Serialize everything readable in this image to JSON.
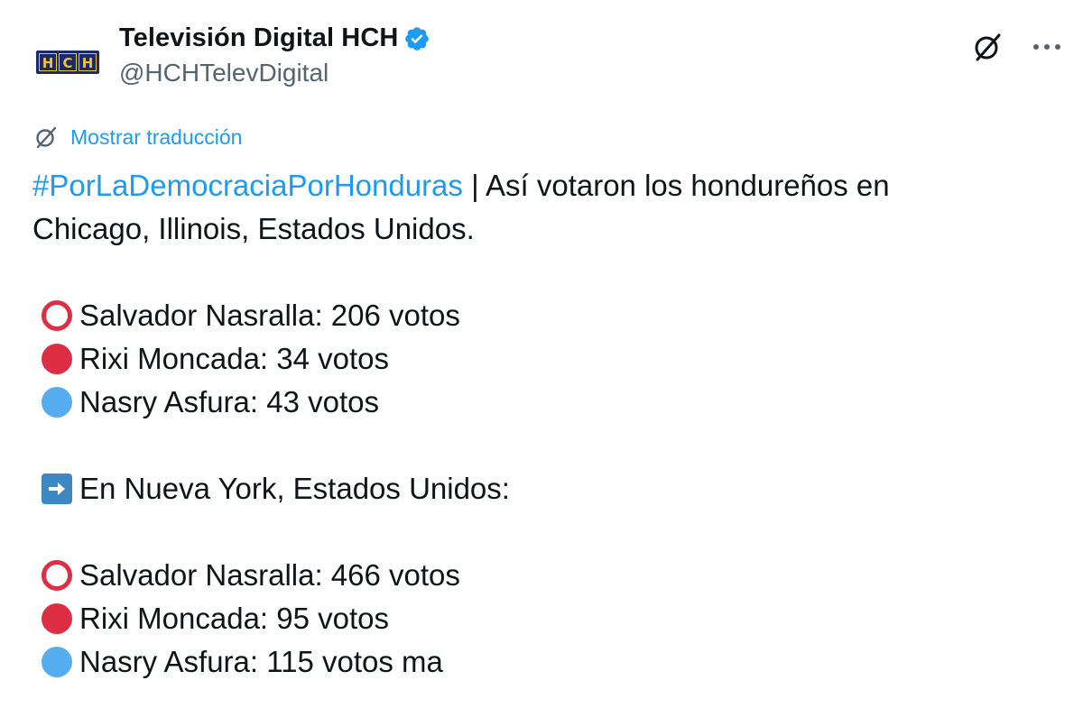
{
  "account": {
    "display_name": "Televisión Digital HCH",
    "handle": "@HCHTelevDigital",
    "logo_letters": [
      "H",
      "C",
      "H"
    ],
    "verified_color": "#1d9bf0"
  },
  "actions": {
    "grok_icon": "grok-slash-icon",
    "more_icon": "more-dots-icon"
  },
  "translate": {
    "label": "Mostrar traducción",
    "icon": "grok-slash-icon"
  },
  "tweet": {
    "hashtag": "#PorLaDemocraciaPorHonduras",
    "intro_rest": " | Así votaron los hondureños en",
    "intro_line2": "Chicago, Illinois, Estados Unidos.",
    "chicago": [
      {
        "icon": "red-ring-icon",
        "text": "Salvador Nasralla: 206 votos"
      },
      {
        "icon": "red-circle-icon",
        "text": "Rixi Moncada: 34 votos"
      },
      {
        "icon": "blue-circle-icon",
        "text": "Nasry Asfura: 43 votos"
      }
    ],
    "ny_heading": "En Nueva York, Estados Unidos:",
    "ny_icon": "right-arrow-icon",
    "new_york": [
      {
        "icon": "red-ring-icon",
        "text": "Salvador Nasralla: 466 votos"
      },
      {
        "icon": "red-circle-icon",
        "text": "Rixi Moncada: 95 votos"
      },
      {
        "icon": "blue-circle-icon",
        "text": "Nasry Asfura: 115 votos ma"
      }
    ]
  },
  "colors": {
    "link": "#1d9bf0",
    "text": "#0f1419",
    "secondary": "#536471",
    "red": "#dd2e44",
    "blue": "#55acee"
  }
}
